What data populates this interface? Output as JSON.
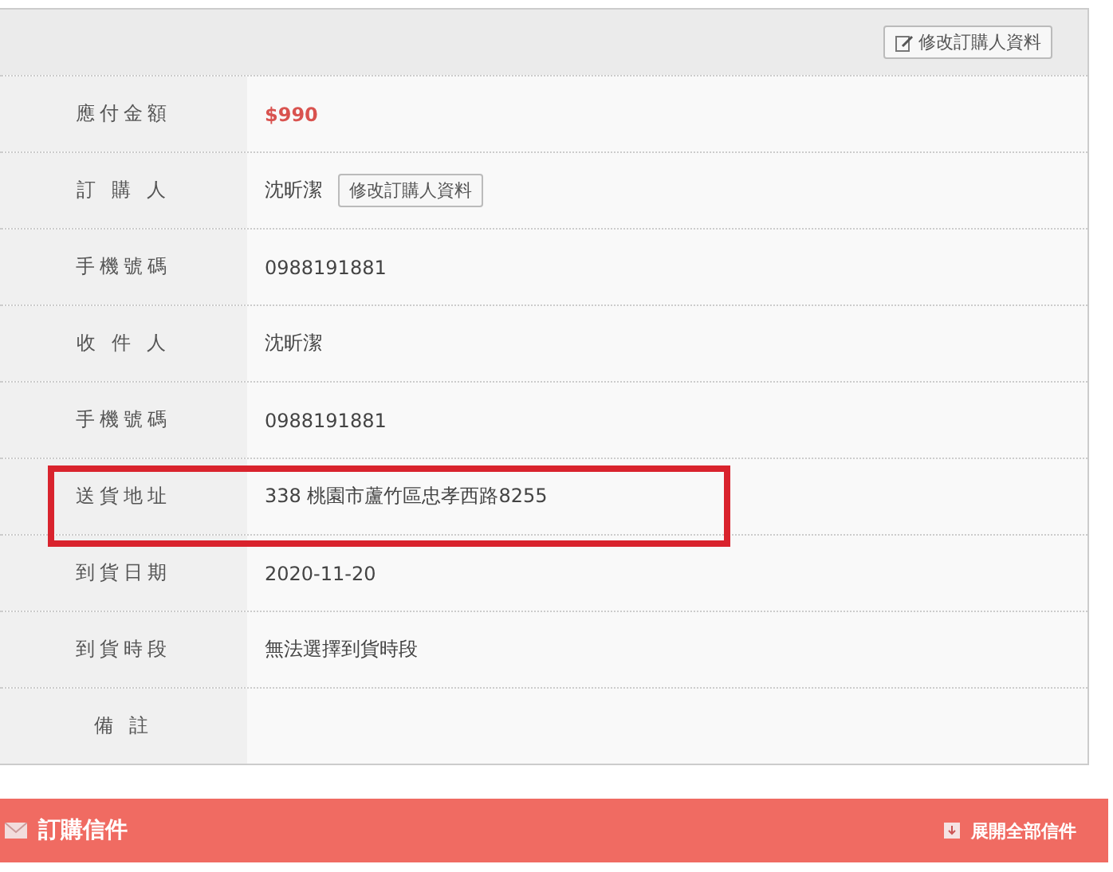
{
  "header": {
    "edit_button": "修改訂購人資料"
  },
  "rows": [
    {
      "kind": "amount",
      "label": "應付金額",
      "value": "$990",
      "highlighted": false
    },
    {
      "kind": "buyer",
      "label": "訂 購 人",
      "value": "沈昕潔",
      "button": "修改訂購人資料",
      "highlighted": false
    },
    {
      "kind": "text",
      "label": "手機號碼",
      "value": "0988191881",
      "highlighted": false
    },
    {
      "kind": "text",
      "label": "收 件 人",
      "value": "沈昕潔",
      "highlighted": false
    },
    {
      "kind": "text",
      "label": "手機號碼",
      "value": "0988191881",
      "highlighted": false
    },
    {
      "kind": "text",
      "label": "送貨地址",
      "value": "338 桃園市蘆竹區忠孝西路8255",
      "highlighted": true
    },
    {
      "kind": "text",
      "label": "到貨日期",
      "value": "2020-11-20",
      "highlighted": false
    },
    {
      "kind": "text",
      "label": "到貨時段",
      "value": "無法選擇到貨時段",
      "highlighted": false
    },
    {
      "kind": "text",
      "label": "備 註",
      "highlighted": false
    }
  ],
  "mail_bar": {
    "title": "訂購信件",
    "expand_link": "展開全部信件"
  }
}
